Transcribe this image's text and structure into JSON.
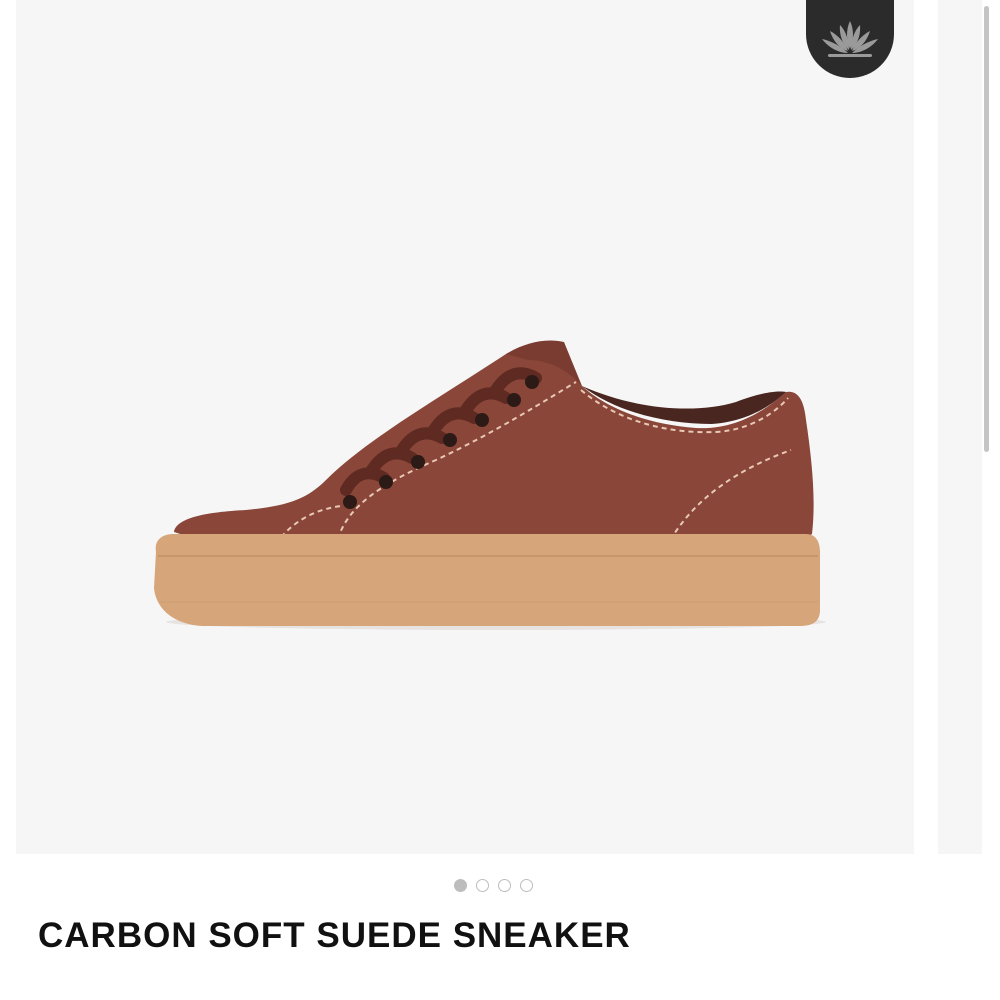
{
  "product": {
    "title": "CARBON SOFT SUEDE SNEAKER",
    "image_alt": "brown suede low-top sneaker with gum sole",
    "colors": {
      "upper": "#8a4638",
      "sole": "#d6a57a",
      "background": "#f6f6f6",
      "badge": "#2b2b2b"
    }
  },
  "badge": {
    "icon": "lotus-icon"
  },
  "carousel": {
    "total_slides": 4,
    "active_index": 0
  }
}
